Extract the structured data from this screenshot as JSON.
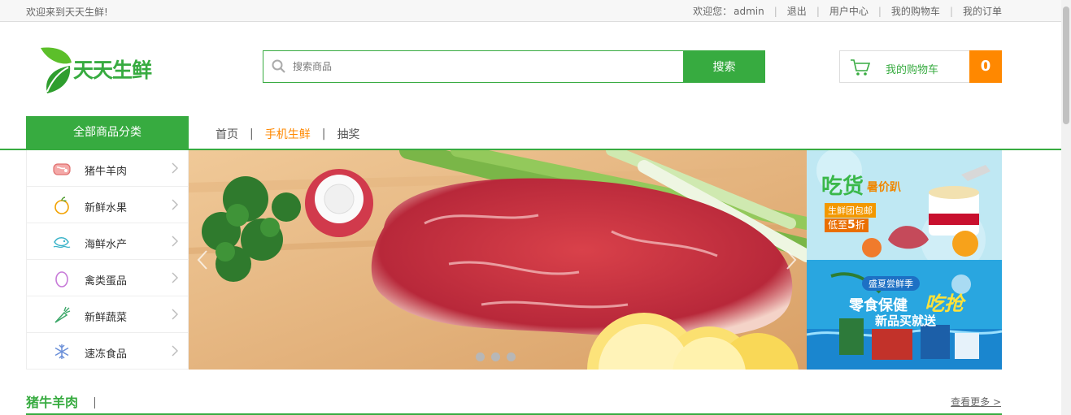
{
  "topbar": {
    "welcome": "欢迎来到天天生鲜!",
    "greeting": "欢迎您：",
    "username": "admin",
    "links": [
      "退出",
      "用户中心",
      "我的购物车",
      "我的订单"
    ]
  },
  "logo": {
    "text": "天天生鲜"
  },
  "search": {
    "placeholder": "搜索商品",
    "button": "搜索"
  },
  "cart": {
    "label": "我的购物车",
    "count": "0"
  },
  "nav": {
    "all_categories": "全部商品分类",
    "links": [
      "首页",
      "手机生鲜",
      "抽奖"
    ],
    "active": "手机生鲜"
  },
  "categories": [
    {
      "label": "猪牛羊肉",
      "icon": "meat-icon"
    },
    {
      "label": "新鲜水果",
      "icon": "fruit-icon"
    },
    {
      "label": "海鲜水产",
      "icon": "fish-icon"
    },
    {
      "label": "禽类蛋品",
      "icon": "egg-icon"
    },
    {
      "label": "新鲜蔬菜",
      "icon": "carrot-icon"
    },
    {
      "label": "速冻食品",
      "icon": "snowflake-icon"
    }
  ],
  "promos": {
    "p1": {
      "headline": "吃货",
      "sub": "暑价趴",
      "line1": "生鲜团包邮",
      "line2": "低至",
      "num": "5",
      "unit": "折"
    },
    "p2": {
      "tag": "盛夏尝鲜季",
      "headline": "零食保健",
      "accent": "吃抢",
      "sub": "新品买就送"
    }
  },
  "section": {
    "title": "猪牛羊肉",
    "more": "查看更多 >"
  },
  "colors": {
    "brand": "#37ab40",
    "accent": "#ff8800"
  }
}
